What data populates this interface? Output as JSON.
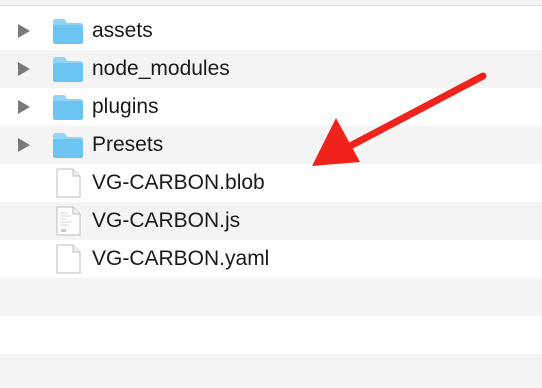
{
  "file_list": {
    "items": [
      {
        "label": "assets",
        "kind": "folder",
        "icon": "folder-icon",
        "expandable": true
      },
      {
        "label": "node_modules",
        "kind": "folder",
        "icon": "folder-icon",
        "expandable": true
      },
      {
        "label": "plugins",
        "kind": "folder",
        "icon": "folder-icon",
        "expandable": true
      },
      {
        "label": "Presets",
        "kind": "folder",
        "icon": "folder-icon",
        "expandable": true
      },
      {
        "label": "VG-CARBON.blob",
        "kind": "file",
        "icon": "document-icon",
        "expandable": false
      },
      {
        "label": "VG-CARBON.js",
        "kind": "file",
        "icon": "js-file-icon",
        "expandable": false
      },
      {
        "label": "VG-CARBON.yaml",
        "kind": "file",
        "icon": "document-icon",
        "expandable": false
      }
    ]
  },
  "annotation": {
    "icon": "red-arrow-icon",
    "color": "#f0231c",
    "target": "VG-CARBON.blob"
  },
  "colors": {
    "folder_body": "#6cc4f2",
    "folder_tab": "#8fd3f6",
    "row_alternate": "#f4f4f4",
    "disclosure": "#7a7a7a"
  }
}
